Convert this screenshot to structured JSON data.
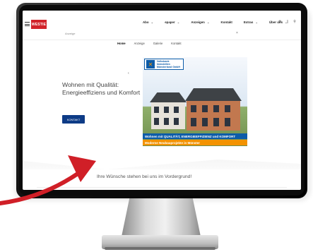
{
  "site": {
    "logo_text": "WESTIE",
    "nav": [
      {
        "label": "Abo",
        "chevron": "⌄"
      },
      {
        "label": "epaper",
        "chevron": "⌄"
      },
      {
        "label": "Anzeigen",
        "chevron": "⌄"
      },
      {
        "label": "Kontakt",
        "chevron": ""
      },
      {
        "label": "Extras",
        "chevron": "⌄"
      },
      {
        "label": "Über uns",
        "chevron": "⌄"
      }
    ],
    "icons": [
      "settings-icon",
      "account-icon",
      "search-icon"
    ]
  },
  "ad": {
    "label": "Anzeige",
    "close": "×",
    "subnav": [
      "Home",
      "Anzeige",
      "Galerie",
      "Kontakt"
    ],
    "headline": "Wohnen mit Qualität: Energieeffiziens und Komfort",
    "button": "KONTAKT",
    "prev_arrow": "‹",
    "bank_name_line1": "Volksbank Immobilien",
    "bank_name_line2": "Münsterland GmbH",
    "banner_1": "Wohnen mit QUALITÄT, ENERGIEEFFIZIENZ und KOMFORT",
    "banner_2": "Moderne Neubauprojekte in Münster"
  },
  "tagline": "Ihre Wünsche stehen bei uns im Vordergrund!",
  "colors": {
    "brand_red": "#d2232a",
    "bank_blue": "#0d5ca8",
    "bank_orange": "#f39200",
    "button_blue": "#0d3b86",
    "arrow_red": "#d01f27"
  }
}
